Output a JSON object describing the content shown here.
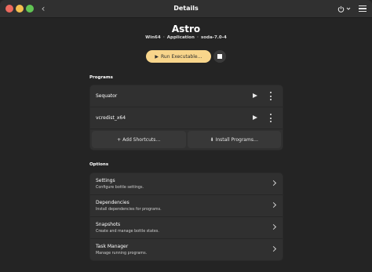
{
  "header": {
    "title": "Details",
    "back_icon": "chevron-left-icon",
    "power_icon": "power-icon",
    "menu_icon": "hamburger-icon"
  },
  "bottle": {
    "name": "Astro",
    "arch": "Win64",
    "type": "Application",
    "runner": "soda-7.0-4"
  },
  "run_button": {
    "label": "Run Executable…"
  },
  "programs": {
    "section_label": "Programs",
    "items": [
      {
        "name": "Sequator"
      },
      {
        "name": "vcredist_x64"
      }
    ],
    "add_shortcuts_label": "Add Shortcuts…",
    "install_programs_label": "Install Programs…"
  },
  "options": {
    "section_label": "Options",
    "items": [
      {
        "title": "Settings",
        "subtitle": "Configure bottle settings."
      },
      {
        "title": "Dependencies",
        "subtitle": "Install dependencies for programs."
      },
      {
        "title": "Snapshots",
        "subtitle": "Create and manage bottle states."
      },
      {
        "title": "Task Manager",
        "subtitle": "Manage running programs."
      }
    ]
  },
  "colors": {
    "accent": "#f8d58b",
    "background": "#242424",
    "card": "#303030"
  }
}
